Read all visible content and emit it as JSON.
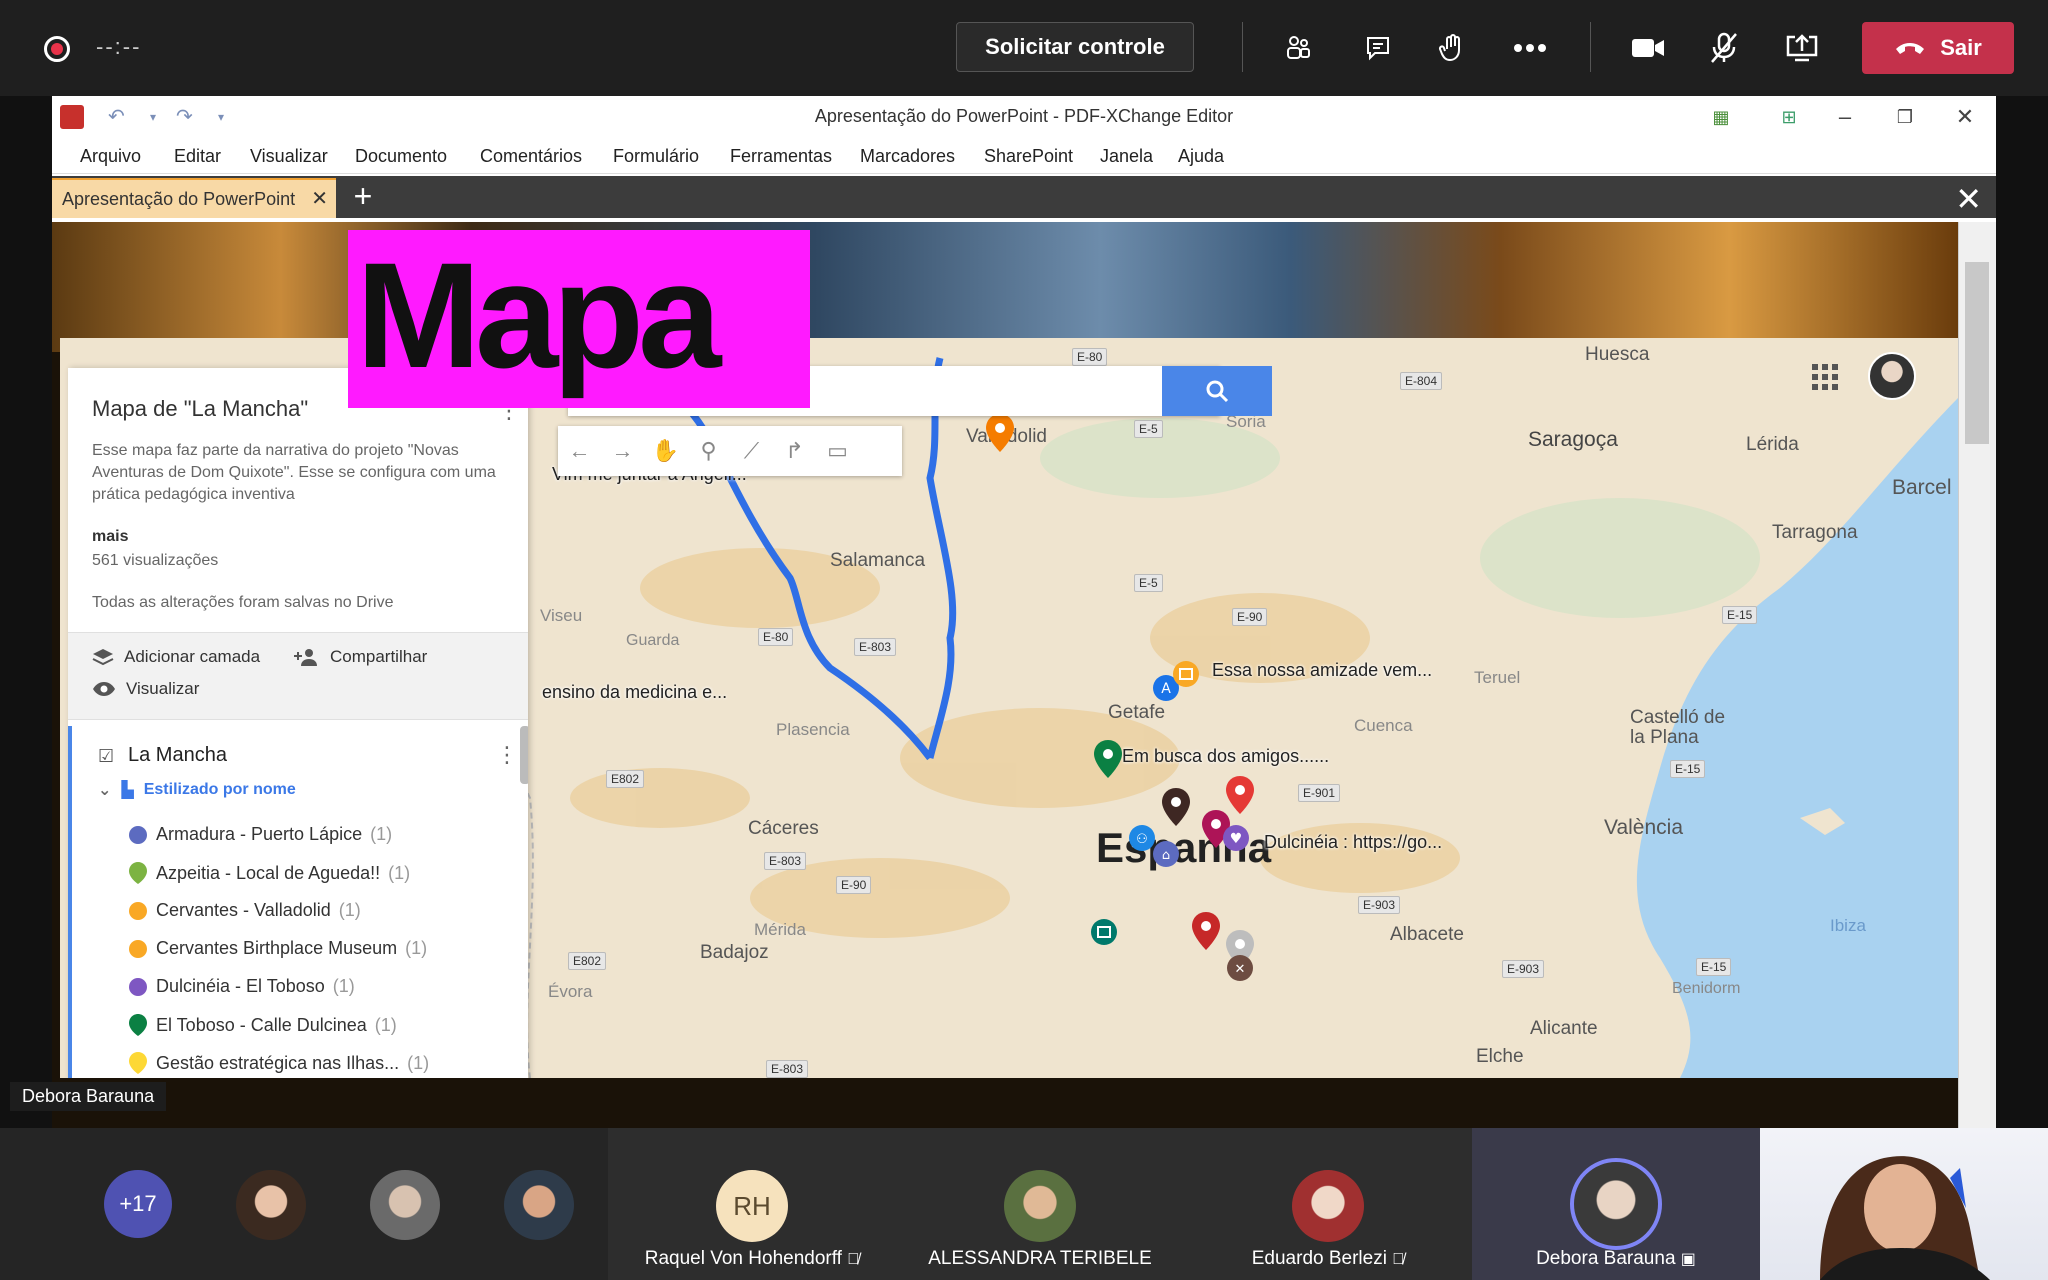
{
  "teams": {
    "recording_time": "--:--",
    "request_control_label": "Solicitar controle",
    "leave_label": "Sair",
    "accent": "#c4314b"
  },
  "window": {
    "title": "Apresentação do PowerPoint - PDF-XChange Editor",
    "menu": [
      "Arquivo",
      "Editar",
      "Visualizar",
      "Documento",
      "Comentários",
      "Formulário",
      "Ferramentas",
      "Marcadores",
      "SharePoint",
      "Janela",
      "Ajuda"
    ],
    "tab_label": "Apresentação do PowerPoint"
  },
  "slide": {
    "title": "Mapa",
    "title_bg": "#ff1aff"
  },
  "map_panel": {
    "title": "Mapa de \"La Mancha\"",
    "description": "Esse mapa faz parte da narrativa do projeto \"Novas Aventuras de Dom Quixote\". Esse se configura com uma prática pedagógica inventiva",
    "more": "mais",
    "views": "561 visualizações",
    "saved": "Todas as alterações foram salvas no Drive",
    "add_layer": "Adicionar camada",
    "share": "Compartilhar",
    "preview": "Visualizar",
    "layer_name": "La Mancha",
    "layer_style": "Estilizado por nome",
    "features": [
      {
        "name": "Armadura - Puerto Lápice",
        "count": "(1)",
        "color": "#5c6bc0"
      },
      {
        "name": "Azpeitia - Local de Agueda!!",
        "count": "(1)",
        "color": "#7cb342"
      },
      {
        "name": "Cervantes - Valladolid",
        "count": "(1)",
        "color": "#f9a825"
      },
      {
        "name": "Cervantes Birthplace Museum",
        "count": "(1)",
        "color": "#f9a825"
      },
      {
        "name": "Dulcinéia - El Toboso",
        "count": "(1)",
        "color": "#7e57c2"
      },
      {
        "name": "El Toboso - Calle Dulcinea",
        "count": "(1)",
        "color": "#0b8043"
      },
      {
        "name": "Gestão estratégica nas Ilhas...",
        "count": "(1)",
        "color": "#fdd835"
      }
    ]
  },
  "map": {
    "cities": [
      {
        "name": "Huesca"
      },
      {
        "name": "Saragoça"
      },
      {
        "name": "Lérida"
      },
      {
        "name": "Barcel"
      },
      {
        "name": "Tarragona"
      },
      {
        "name": "Soria"
      },
      {
        "name": "Salamanca"
      },
      {
        "name": "Getafe"
      },
      {
        "name": "Plasencia"
      },
      {
        "name": "Cáceres"
      },
      {
        "name": "Mérida"
      },
      {
        "name": "Badajoz"
      },
      {
        "name": "Cuenca"
      },
      {
        "name": "Teruel"
      },
      {
        "name": "Castelló de la Plana"
      },
      {
        "name": "València"
      },
      {
        "name": "Albacete"
      },
      {
        "name": "Alicante"
      },
      {
        "name": "Elche"
      },
      {
        "name": "Benidorm"
      },
      {
        "name": "Ibiza"
      },
      {
        "name": "Évora"
      },
      {
        "name": "Viseu"
      },
      {
        "name": "Guarda"
      },
      {
        "name": "Valladolid"
      }
    ],
    "country": "Espanha",
    "callouts": {
      "juntar": "Vim me juntar a Angeli...",
      "amizade": "Essa nossa amizade vem...",
      "amigos": "Em busca dos amigos......",
      "dulcineia": "Dulcinéia : https://go...",
      "medicina": "ensino da medicina e..."
    },
    "roads": [
      "E-80",
      "E-804",
      "E-5",
      "E-90",
      "E-80",
      "E-803",
      "E-5",
      "E-15",
      "E-901",
      "E802",
      "E-803",
      "E-90",
      "E-903",
      "E802",
      "E-903",
      "E-15",
      "E-803",
      "E-15"
    ]
  },
  "presenter": "Debora Barauna",
  "participants": {
    "more_count": "+17",
    "tiles": [
      {
        "initials": "RH",
        "name": "Raquel Von Hohendorff"
      },
      {
        "name": "ALESSANDRA TERIBELE"
      },
      {
        "name": "Eduardo Berlezi"
      },
      {
        "name": "Debora Barauna"
      }
    ]
  }
}
